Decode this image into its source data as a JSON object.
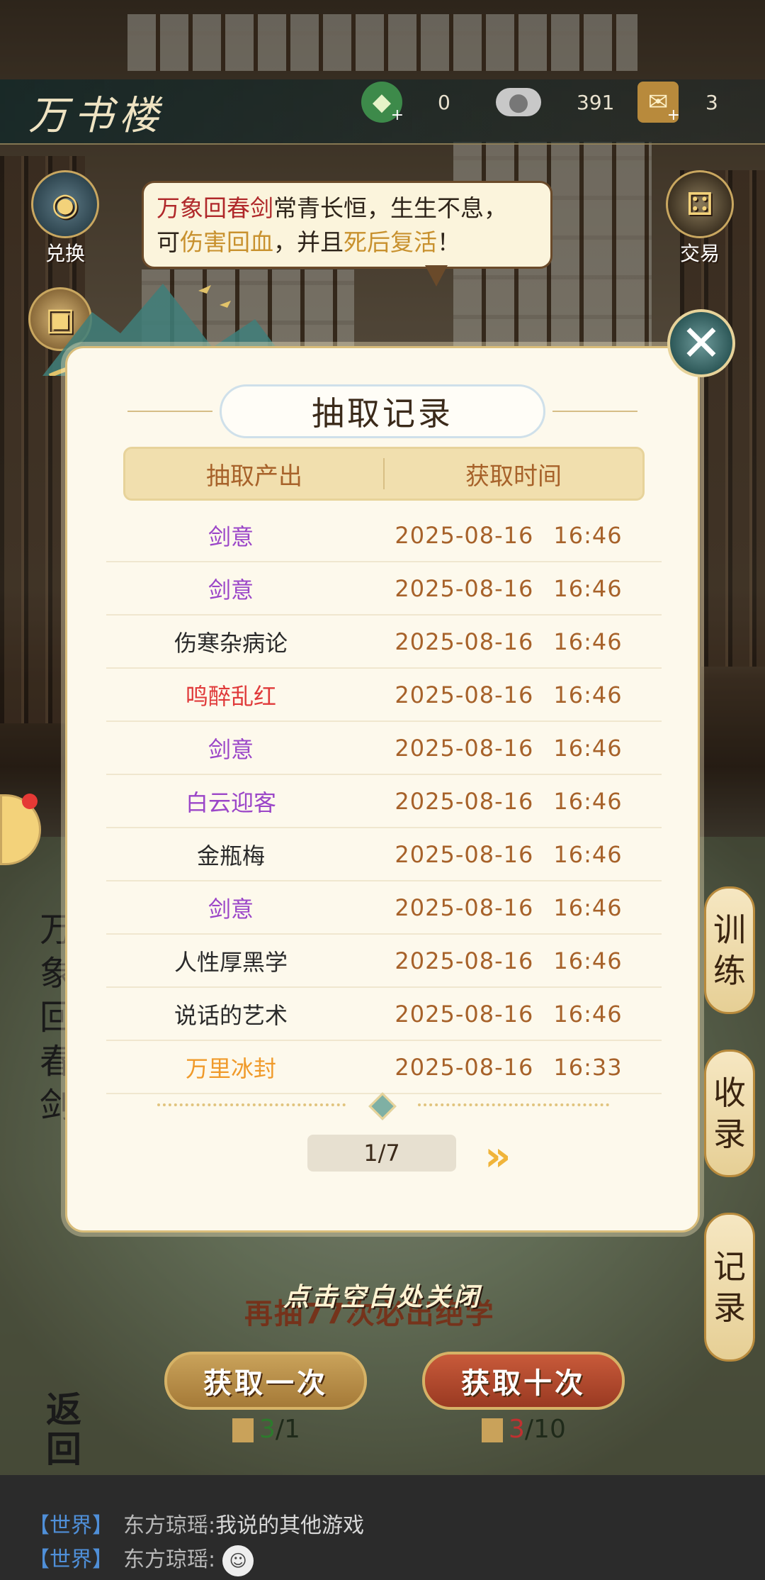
{
  "topbar": {
    "title": "万书楼",
    "resources": [
      {
        "icon": "jade-token-icon",
        "value": "0"
      },
      {
        "icon": "silver-ingot-icon",
        "value": "391"
      },
      {
        "icon": "scroll-ticket-icon",
        "value": "3"
      }
    ]
  },
  "side_buttons": {
    "exchange": "兑换",
    "trade": "交易"
  },
  "bubble": {
    "part1": "万象回春剑",
    "part2": "常青长恒，生生不息，",
    "part3": "可",
    "part4": "伤害回血",
    "part5": "，并且",
    "part6": "死后复活",
    "part7": "！"
  },
  "vertical_tabs": {
    "train": [
      "训",
      "练"
    ],
    "collect": [
      "收",
      "录"
    ],
    "record": [
      "记",
      "录"
    ]
  },
  "left_vertical_title": [
    "万",
    "象",
    "回",
    "春",
    "剑"
  ],
  "modal": {
    "title": "抽取记录",
    "col_item": "抽取产出",
    "col_time": "获取时间",
    "rows": [
      {
        "item": "剑意",
        "date": "2025-08-16",
        "time": "16:46",
        "color": "#9b46c8"
      },
      {
        "item": "剑意",
        "date": "2025-08-16",
        "time": "16:46",
        "color": "#9b46c8"
      },
      {
        "item": "伤寒杂病论",
        "date": "2025-08-16",
        "time": "16:46",
        "color": "#2a2a2a"
      },
      {
        "item": "鸣醉乱红",
        "date": "2025-08-16",
        "time": "16:46",
        "color": "#e03a3a"
      },
      {
        "item": "剑意",
        "date": "2025-08-16",
        "time": "16:46",
        "color": "#9b46c8"
      },
      {
        "item": "白云迎客",
        "date": "2025-08-16",
        "time": "16:46",
        "color": "#9b46c8"
      },
      {
        "item": "金瓶梅",
        "date": "2025-08-16",
        "time": "16:46",
        "color": "#2a2a2a"
      },
      {
        "item": "剑意",
        "date": "2025-08-16",
        "time": "16:46",
        "color": "#9b46c8"
      },
      {
        "item": "人性厚黑学",
        "date": "2025-08-16",
        "time": "16:46",
        "color": "#2a2a2a"
      },
      {
        "item": "说话的艺术",
        "date": "2025-08-16",
        "time": "16:46",
        "color": "#2a2a2a"
      },
      {
        "item": "万里冰封",
        "date": "2025-08-16",
        "time": "16:33",
        "color": "#f09a2a"
      }
    ],
    "page": "1/7"
  },
  "bottom": {
    "close_hint": "点击空白处关闭",
    "pity_hint": "再抽77次必出绝学",
    "draw_one": "获取一次",
    "draw_ten": "获取十次",
    "cost_one_have": "3",
    "cost_one_need": "/1",
    "cost_ten_have": "3",
    "cost_ten_need": "/10",
    "back": [
      "返",
      "回"
    ]
  },
  "chat": [
    {
      "channel": "【世界】",
      "name": "东方琼瑶:",
      "text": "我说的其他游戏"
    },
    {
      "channel": "【世界】",
      "name": "东方琼瑶:",
      "text": ""
    }
  ],
  "colors": {
    "accent_gold": "#d6b266",
    "time_text": "#a7622a",
    "purple_rarity": "#9b46c8",
    "red_rarity": "#e03a3a",
    "orange_rarity": "#f09a2a"
  }
}
